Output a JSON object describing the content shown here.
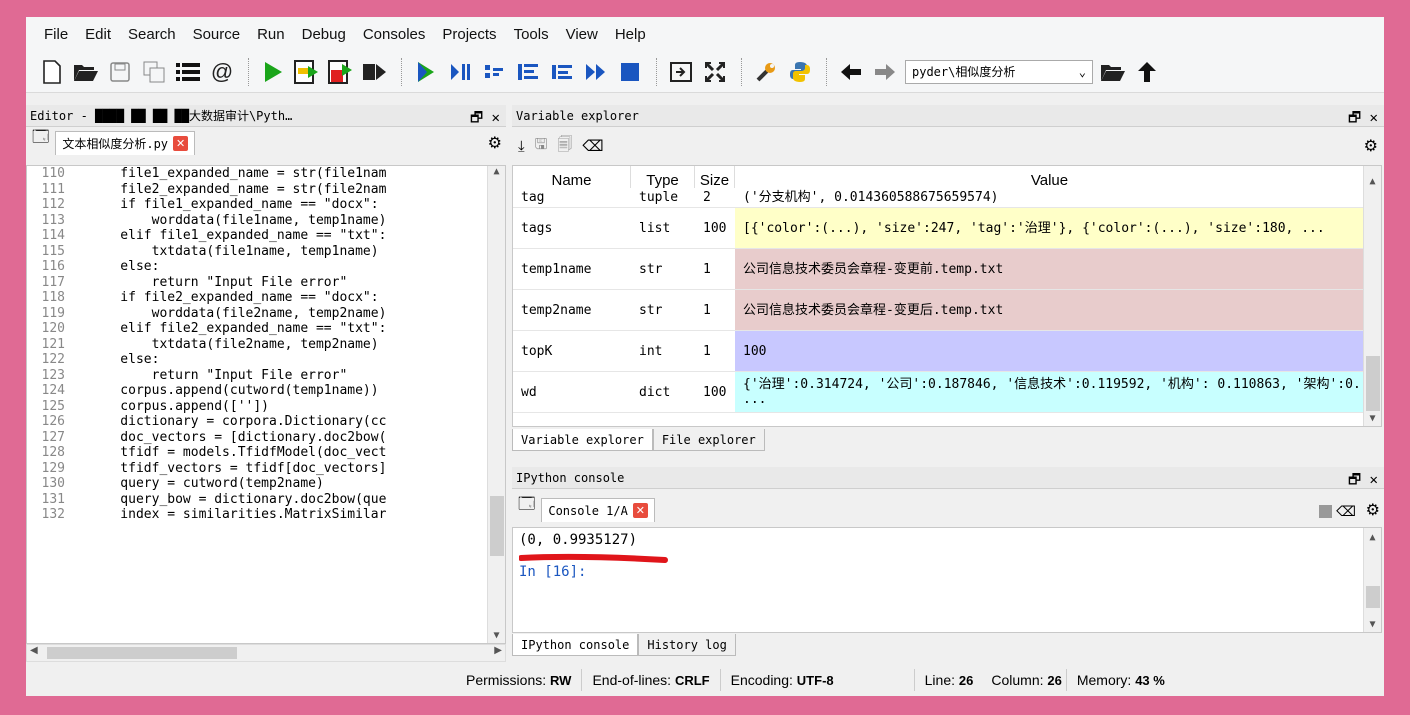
{
  "menu": [
    "File",
    "Edit",
    "Search",
    "Source",
    "Run",
    "Debug",
    "Consoles",
    "Projects",
    "Tools",
    "View",
    "Help"
  ],
  "toolbar": {
    "path_value": "pyder\\相似度分析",
    "dropdown_arrow": "⌄"
  },
  "editor": {
    "pane_title": "Editor - ████ ██ ██ ██大数据审计\\Pyth…",
    "tab_label": "文本相似度分析.py",
    "lines": [
      {
        "n": "110",
        "code": "    file1_expanded_name = str(file1nam"
      },
      {
        "n": "111",
        "code": "    file2_expanded_name = str(file2nam"
      },
      {
        "n": "112",
        "code": "    if file1_expanded_name == \"docx\":"
      },
      {
        "n": "113",
        "code": "        worddata(file1name, temp1name)"
      },
      {
        "n": "114",
        "code": "    elif file1_expanded_name == \"txt\":"
      },
      {
        "n": "115",
        "code": "        txtdata(file1name, temp1name)"
      },
      {
        "n": "116",
        "code": "    else:"
      },
      {
        "n": "117",
        "code": "        return \"Input File error\""
      },
      {
        "n": "118",
        "code": "    if file2_expanded_name == \"docx\":"
      },
      {
        "n": "119",
        "code": "        worddata(file2name, temp2name)"
      },
      {
        "n": "120",
        "code": "    elif file2_expanded_name == \"txt\":"
      },
      {
        "n": "121",
        "code": "        txtdata(file2name, temp2name)"
      },
      {
        "n": "122",
        "code": "    else:"
      },
      {
        "n": "123",
        "code": "        return \"Input File error\""
      },
      {
        "n": "124",
        "code": "    corpus.append(cutword(temp1name))"
      },
      {
        "n": "125",
        "code": "    corpus.append([''])"
      },
      {
        "n": "126",
        "code": "    dictionary = corpora.Dictionary(cc"
      },
      {
        "n": "127",
        "code": "    doc_vectors = [dictionary.doc2bow("
      },
      {
        "n": "128",
        "code": "    tfidf = models.TfidfModel(doc_vect"
      },
      {
        "n": "129",
        "code": "    tfidf_vectors = tfidf[doc_vectors]"
      },
      {
        "n": "130",
        "code": "    query = cutword(temp2name)"
      },
      {
        "n": "131",
        "code": "    query_bow = dictionary.doc2bow(que"
      },
      {
        "n": "132",
        "code": "    index = similarities.MatrixSimilar"
      }
    ]
  },
  "variable_explorer": {
    "pane_title": "Variable explorer",
    "columns": [
      "Name",
      "Type",
      "Size",
      "Value"
    ],
    "rows": [
      {
        "name": "tag",
        "type": "tuple",
        "size": "2",
        "value": "('分支机构', 0.014360588675659574)",
        "color": "#ffffff"
      },
      {
        "name": "tags",
        "type": "list",
        "size": "100",
        "value": "[{'color':(...), 'size':247, 'tag':'治理'}, {'color':(...), 'size':180, ...",
        "color": "#ffffc8"
      },
      {
        "name": "temp1name",
        "type": "str",
        "size": "1",
        "value": "公司信息技术委员会章程-变更前.temp.txt",
        "color": "#e8cccc"
      },
      {
        "name": "temp2name",
        "type": "str",
        "size": "1",
        "value": "公司信息技术委员会章程-变更后.temp.txt",
        "color": "#e8cccc"
      },
      {
        "name": "topK",
        "type": "int",
        "size": "1",
        "value": "100",
        "color": "#c8c8ff"
      },
      {
        "name": "wd",
        "type": "dict",
        "size": "100",
        "value": "{'治理':0.314724, '公司':0.187846, '信息技术':0.119592, '机构': 0.110863, '架构':0. ...",
        "color": "#c8ffff"
      }
    ],
    "tabs": [
      "Variable explorer",
      "File explorer"
    ]
  },
  "ipython": {
    "pane_title": "IPython console",
    "tab_label": "Console 1/A",
    "output": "(0, 0.9935127)",
    "prompt": "In [16]:",
    "tabs": [
      "IPython console",
      "History log"
    ]
  },
  "status": {
    "permissions_label": "Permissions:",
    "permissions": "RW",
    "eol_label": "End-of-lines:",
    "eol": "CRLF",
    "encoding_label": "Encoding:",
    "encoding": "UTF-8",
    "line_label": "Line:",
    "line": "26",
    "column_label": "Column:",
    "column": "26",
    "memory_label": "Memory:",
    "memory": "43 %"
  }
}
